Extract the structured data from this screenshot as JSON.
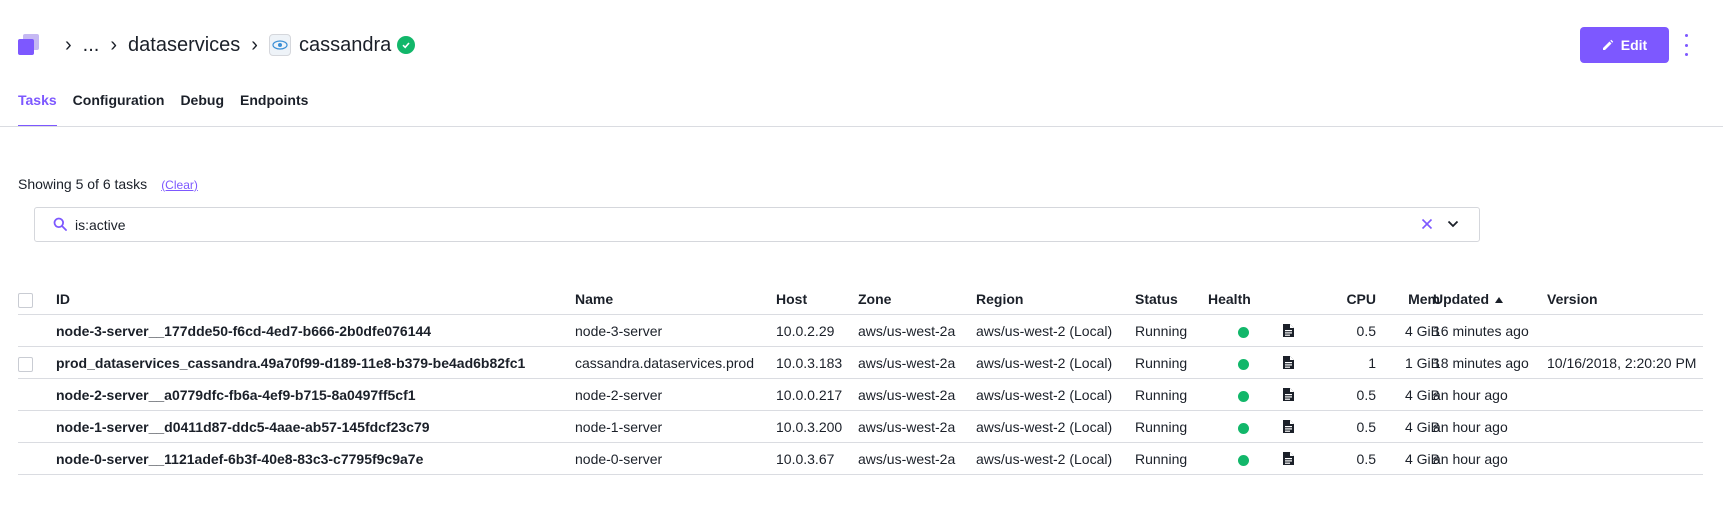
{
  "breadcrumb": {
    "ellipsis": "...",
    "service_group": "dataservices",
    "service_name": "cassandra",
    "status": "healthy"
  },
  "actions": {
    "edit_label": "Edit",
    "accent_color": "#7d58ff"
  },
  "tabs": [
    {
      "label": "Tasks",
      "active": true
    },
    {
      "label": "Configuration",
      "active": false
    },
    {
      "label": "Debug",
      "active": false
    },
    {
      "label": "Endpoints",
      "active": false
    }
  ],
  "filter": {
    "showing_text": "Showing 5 of 6 tasks",
    "clear_label": "(Clear)",
    "search_value": "is:active"
  },
  "table": {
    "columns": {
      "id": "ID",
      "name": "Name",
      "host": "Host",
      "zone": "Zone",
      "region": "Region",
      "status": "Status",
      "health": "Health",
      "cpu": "CPU",
      "mem": "Mem",
      "updated": "Updated",
      "version": "Version"
    },
    "sorted_by": "updated",
    "rows": [
      {
        "id": "node-3-server__177dde50-f6cd-4ed7-b666-2b0dfe076144",
        "name": "node-3-server",
        "host": "10.0.2.29",
        "zone": "aws/us-west-2a",
        "region": "aws/us-west-2 (Local)",
        "status": "Running",
        "health": "healthy",
        "cpu": "0.5",
        "mem": "4 GiB",
        "updated": "16 minutes ago",
        "version": "",
        "has_checkbox": false
      },
      {
        "id": "prod_dataservices_cassandra.49a70f99-d189-11e8-b379-be4ad6b82fc1",
        "name": "cassandra.dataservices.prod",
        "host": "10.0.3.183",
        "zone": "aws/us-west-2a",
        "region": "aws/us-west-2 (Local)",
        "status": "Running",
        "health": "healthy",
        "cpu": "1",
        "mem": "1 GiB",
        "updated": "18 minutes ago",
        "version": "10/16/2018, 2:20:20 PM",
        "has_checkbox": true
      },
      {
        "id": "node-2-server__a0779dfc-fb6a-4ef9-b715-8a0497ff5cf1",
        "name": "node-2-server",
        "host": "10.0.0.217",
        "zone": "aws/us-west-2a",
        "region": "aws/us-west-2 (Local)",
        "status": "Running",
        "health": "healthy",
        "cpu": "0.5",
        "mem": "4 GiB",
        "updated": "an hour ago",
        "version": "",
        "has_checkbox": false
      },
      {
        "id": "node-1-server__d0411d87-ddc5-4aae-ab57-145fdcf23c79",
        "name": "node-1-server",
        "host": "10.0.3.200",
        "zone": "aws/us-west-2a",
        "region": "aws/us-west-2 (Local)",
        "status": "Running",
        "health": "healthy",
        "cpu": "0.5",
        "mem": "4 GiB",
        "updated": "an hour ago",
        "version": "",
        "has_checkbox": false
      },
      {
        "id": "node-0-server__1121adef-6b3f-40e8-83c3-c7795f9c9a7e",
        "name": "node-0-server",
        "host": "10.0.3.67",
        "zone": "aws/us-west-2a",
        "region": "aws/us-west-2 (Local)",
        "status": "Running",
        "health": "healthy",
        "cpu": "0.5",
        "mem": "4 GiB",
        "updated": "an hour ago",
        "version": "",
        "has_checkbox": false
      }
    ]
  }
}
